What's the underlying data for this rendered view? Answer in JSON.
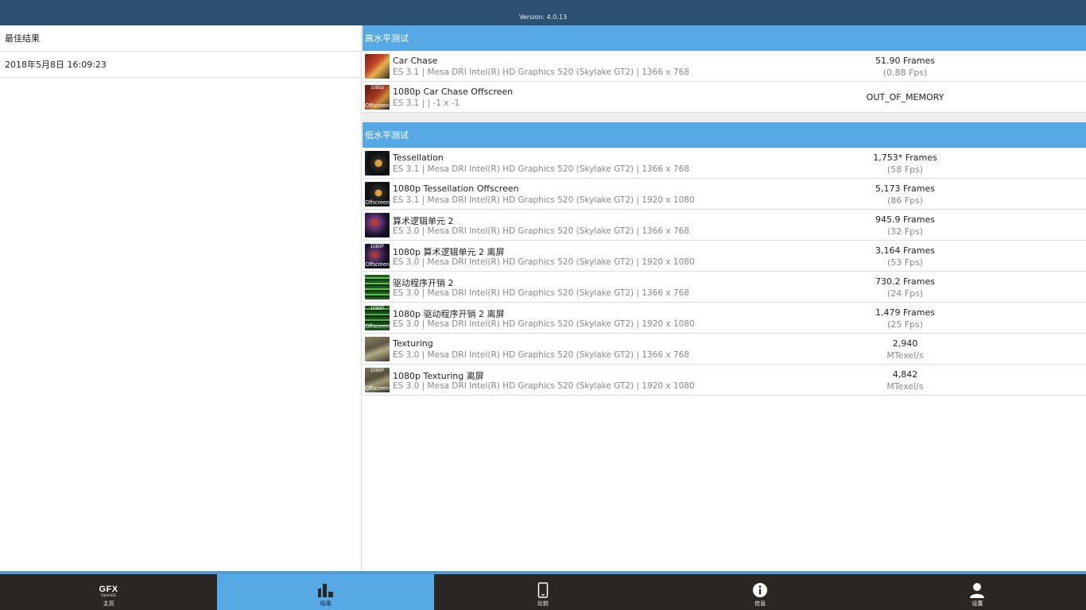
{
  "header": {
    "version": "Version: 4.0.13"
  },
  "left": {
    "title": "最佳结果",
    "date": "2018年5月8日 16:09:23"
  },
  "sections": [
    {
      "title": "高水平测试",
      "rows": [
        {
          "name": "Car Chase",
          "sub": "ES 3.1 | Mesa DRI Intel(R) HD Graphics 520 (Skylake GT2)  | 1366 x 768",
          "r1": "51.90 Frames",
          "r2": "(0.88 Fps)",
          "thumb": "car"
        },
        {
          "name": "1080p Car Chase Offscreen",
          "sub": "ES 3.1 |  | -1 x -1",
          "r1": "OUT_OF_MEMORY",
          "r2": "",
          "thumb": "car-off",
          "thumb_top": "1080p",
          "thumb_cap": "Offscreen"
        }
      ]
    },
    {
      "title": "低水平测试",
      "rows": [
        {
          "name": "Tessellation",
          "sub": "ES 3.1 | Mesa DRI Intel(R) HD Graphics 520 (Skylake GT2)  | 1366 x 768",
          "r1": "1,753* Frames",
          "r2": "(58 Fps)",
          "thumb": "tess"
        },
        {
          "name": "1080p Tessellation Offscreen",
          "sub": "ES 3.1 | Mesa DRI Intel(R) HD Graphics 520 (Skylake GT2)  | 1920 x 1080",
          "r1": "5,173 Frames",
          "r2": "(86 Fps)",
          "thumb": "tess-off",
          "thumb_top": "",
          "thumb_cap": "Offscreen"
        },
        {
          "name": "算术逻辑单元 2",
          "sub": "ES 3.0 | Mesa DRI Intel(R) HD Graphics 520 (Skylake GT2)  | 1366 x 768",
          "r1": "945.9 Frames",
          "r2": "(32 Fps)",
          "thumb": "alu"
        },
        {
          "name": "1080p 算术逻辑单元 2 离屏",
          "sub": "ES 3.0 | Mesa DRI Intel(R) HD Graphics 520 (Skylake GT2)  | 1920 x 1080",
          "r1": "3,164 Frames",
          "r2": "(53 Fps)",
          "thumb": "alu-off",
          "thumb_top": "1080P",
          "thumb_cap": "Offscreen"
        },
        {
          "name": "驱动程序开销 2",
          "sub": "ES 3.0 | Mesa DRI Intel(R) HD Graphics 520 (Skylake GT2)  | 1366 x 768",
          "r1": "730.2 Frames",
          "r2": "(24 Fps)",
          "thumb": "drv"
        },
        {
          "name": "1080p 驱动程序开销 2 离屏",
          "sub": "ES 3.0 | Mesa DRI Intel(R) HD Graphics 520 (Skylake GT2)  | 1920 x 1080",
          "r1": "1,479 Frames",
          "r2": "(25 Fps)",
          "thumb": "drv-off",
          "thumb_top": "1080P",
          "thumb_cap": "Offscreen"
        },
        {
          "name": "Texturing",
          "sub": "ES 3.0 | Mesa DRI Intel(R) HD Graphics 520 (Skylake GT2)  | 1366 x 768",
          "r1": "2,940",
          "r2": "MTexel/s",
          "thumb": "tex"
        },
        {
          "name": "1080p Texturing 离屏",
          "sub": "ES 3.0 | Mesa DRI Intel(R) HD Graphics 520 (Skylake GT2)  | 1920 x 1080",
          "r1": "4,842",
          "r2": "MTexel/s",
          "thumb": "tex-off",
          "thumb_top": "1080P",
          "thumb_cap": "Offscreen"
        }
      ]
    }
  ],
  "nav": {
    "home": {
      "logo": "GFX",
      "logo_sub": "OpenGL",
      "label": "主页",
      "icon": "gfx-logo-icon"
    },
    "results": {
      "label": "结果",
      "icon": "bar-chart-icon"
    },
    "compare": {
      "label": "比较",
      "icon": "phone-icon"
    },
    "info": {
      "label": "信息",
      "icon": "info-icon"
    },
    "settings": {
      "label": "设置",
      "icon": "user-icon"
    }
  },
  "colors": {
    "topbar": "#2c5170",
    "section": "#56a8e4",
    "bottombar": "#2a2624",
    "active_tab": "#56a8e4"
  }
}
